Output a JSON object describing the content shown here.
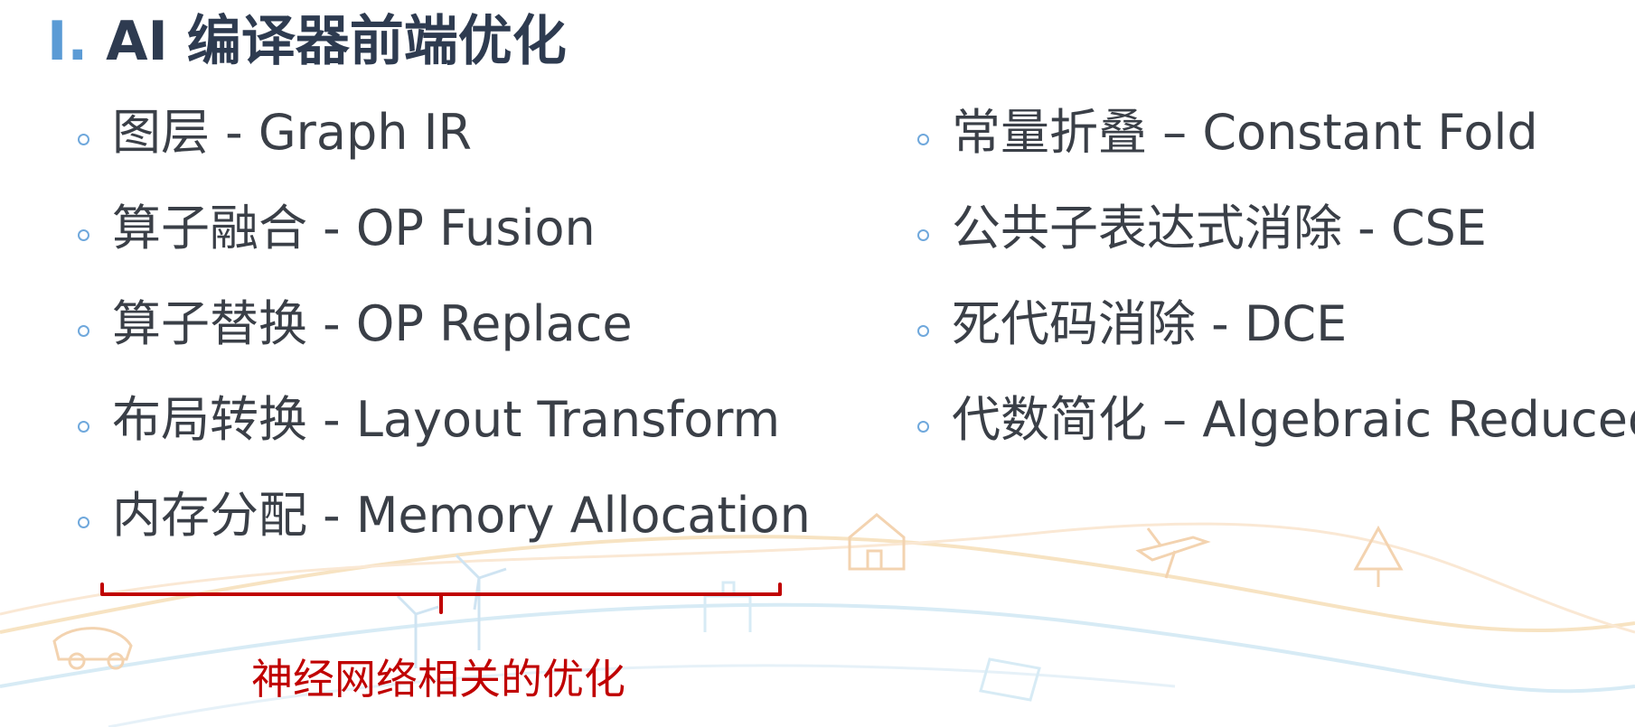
{
  "slide": {
    "title_number": "I.",
    "title_text": "AI 编译器前端优化"
  },
  "left_items": [
    "图层 - Graph IR",
    "算子融合 - OP Fusion",
    "算子替换 - OP Replace",
    "布局转换 - Layout Transform",
    "内存分配 - Memory Allocation"
  ],
  "right_items": [
    "常量折叠 – Constant Fold",
    "公共子表达式消除 - CSE",
    "死代码消除 - DCE",
    "代数简化 – Algebraic Reduced"
  ],
  "annotation": {
    "caption": "神经网络相关的优化"
  },
  "colors": {
    "title": "#2e3b50",
    "title_number": "#5b9bd5",
    "bullet": "#6fa8dc",
    "body_text": "#3a3f47",
    "bracket": "#c00000",
    "caption": "#c00000"
  }
}
